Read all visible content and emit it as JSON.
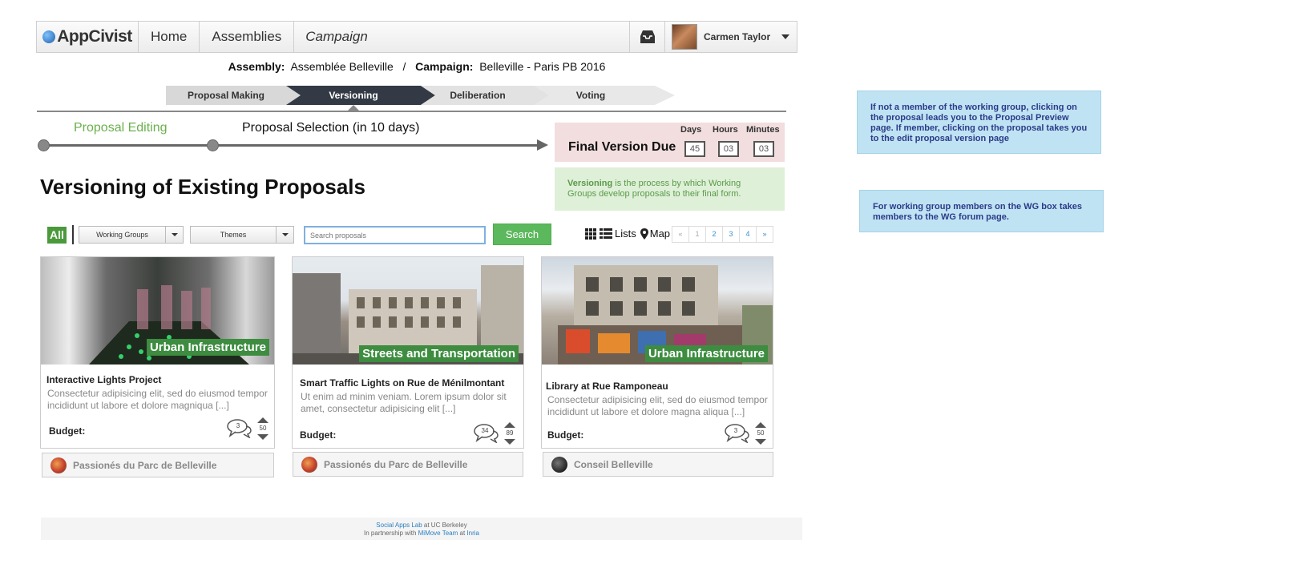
{
  "nav": {
    "logo": "AppCivist",
    "home": "Home",
    "assemblies": "Assemblies",
    "campaign": "Campaign",
    "inbox_icon": "inbox-icon",
    "user_name": "Carmen Taylor"
  },
  "breadcrumb": {
    "assembly_label": "Assembly:",
    "assembly_value": "Assemblée Belleville",
    "separator": "/",
    "campaign_label": "Campaign:",
    "campaign_value": "Belleville - Paris PB 2016"
  },
  "phases": [
    {
      "label": "Proposal Making",
      "active": false
    },
    {
      "label": "Versioning",
      "active": true
    },
    {
      "label": "Deliberation",
      "active": false
    },
    {
      "label": "Voting",
      "active": false
    }
  ],
  "timeline": {
    "stage1": "Proposal Editing",
    "stage2": "Proposal Selection (in 10 days)"
  },
  "countdown": {
    "title": "Final Version Due",
    "days_label": "Days",
    "hours_label": "Hours",
    "minutes_label": "Minutes",
    "days": "45",
    "hours": "03",
    "minutes": "03"
  },
  "info": {
    "term": "Versioning",
    "text": " is the process by which Working Groups develop proposals to their final form."
  },
  "page_title": "Versioning of Existing Proposals",
  "filters": {
    "all": "All",
    "working_groups": "Working Groups",
    "themes": "Themes",
    "search_placeholder": "Search proposals",
    "search_button": "Search",
    "lists": "Lists",
    "map": "Map"
  },
  "pager": [
    "«",
    "1",
    "2",
    "3",
    "4",
    "»"
  ],
  "cards": [
    {
      "tag": "Urban Infrastructure",
      "title": "Interactive Lights Project",
      "desc": "Consectetur adipisicing elit, sed do eiusmod tempor incididunt ut labore et dolore magniqua [...]",
      "budget": "Budget:",
      "comments": "3",
      "votes": "50",
      "group": "Passionés du Parc de Belleville"
    },
    {
      "tag": "Streets and Transportation",
      "title": "Smart Traffic Lights on Rue de Ménilmontant",
      "desc": "Ut enim ad minim veniam. Lorem ipsum dolor sit amet, consectetur adipisicing elit [...]",
      "budget": "Budget:",
      "comments": "34",
      "votes": "89",
      "group": "Passionés du Parc de Belleville"
    },
    {
      "tag": "Urban Infrastructure",
      "title": "Library at Rue Ramponeau",
      "desc": "Consectetur adipisicing elit, sed do eiusmod tempor incididunt ut labore et dolore magna aliqua [...]",
      "budget": "Budget:",
      "comments": "3",
      "votes": "50",
      "group": "Conseil Belleville"
    }
  ],
  "footer": {
    "lab": "Social Apps Lab",
    "at1": " at UC Berkeley",
    "partnership": "In partnership with ",
    "team": "MiMove Team",
    "at2": " at ",
    "inria": "Inria"
  },
  "notes": [
    "If not a member of the working group, clicking on the proposal leads you to the Proposal Preview page. If member, clicking on the proposal takes you to the edit proposal version page",
    "For working group members on the WG box takes members to the WG forum page."
  ],
  "colors": {
    "accent_green": "#5cb85c",
    "tag_green": "#3d8c40",
    "note_blue": "#bfe3f2",
    "final_pink": "#f2dede",
    "info_green": "#dff0d8"
  }
}
